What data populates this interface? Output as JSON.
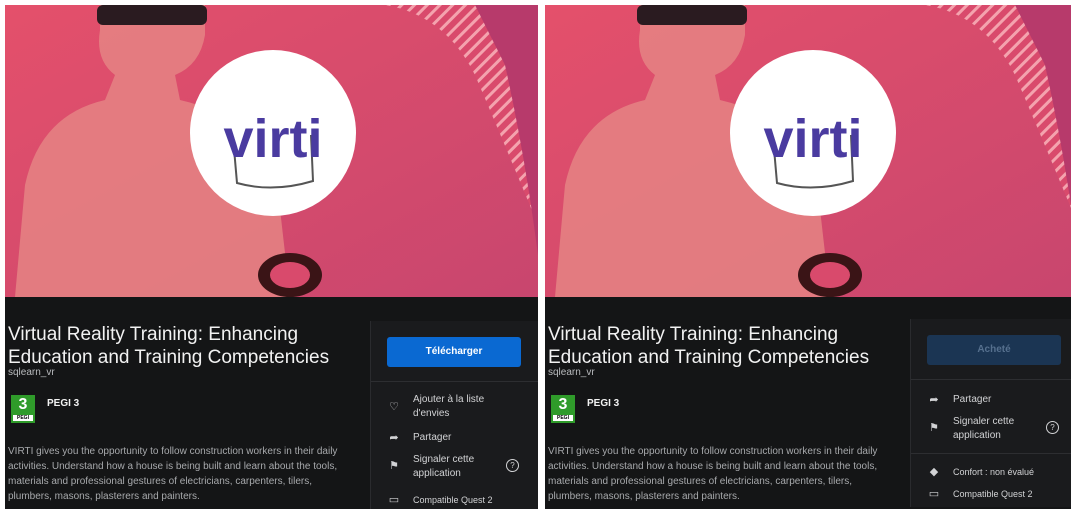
{
  "colors": {
    "accent": "#0a69d2",
    "pegi_green": "#2f9b2a",
    "bg_dark": "#141516"
  },
  "logo_text": "virti",
  "left": {
    "title": "Virtual Reality Training: Enhancing Education and Training Competencies",
    "publisher": "sqlearn_vr",
    "pegi": {
      "age": "3",
      "tag": "PEGI",
      "label": "PEGI 3"
    },
    "description": "VIRTI gives you the opportunity to follow construction workers in their daily activities. Understand how a house is being built and learn about the tools, materials and professional gestures of electricians, carpenters, tilers, plumbers, masons, plasterers and painters.",
    "button": "Télécharger",
    "actions": {
      "wishlist": "Ajouter à la liste d'envies",
      "share": "Partager",
      "report": "Signaler cette application",
      "compat": "Compatible Quest 2"
    },
    "icons": {
      "wishlist": "heart-icon",
      "share": "share-arrow-icon",
      "report": "flag-icon",
      "help": "help-circle-icon",
      "compat": "vr-headset-icon"
    }
  },
  "right": {
    "title": "Virtual Reality Training: Enhancing Education and Training Competencies",
    "publisher": "sqlearn_vr",
    "pegi": {
      "age": "3",
      "tag": "PEGI",
      "label": "PEGI 3"
    },
    "description": "VIRTI gives you the opportunity to follow construction workers in their daily activities. Understand how a house is being built and learn about the tools, materials and professional gestures of electricians, carpenters, tilers, plumbers, masons, plasterers and painters.",
    "button": "Acheté",
    "actions": {
      "share": "Partager",
      "report": "Signaler cette application",
      "comfort": "Confort : non évalué",
      "compat": "Compatible Quest 2"
    },
    "icons": {
      "share": "share-arrow-icon",
      "report": "flag-icon",
      "help": "help-circle-icon",
      "comfort": "comfort-diamond-icon",
      "compat": "vr-headset-icon"
    }
  }
}
